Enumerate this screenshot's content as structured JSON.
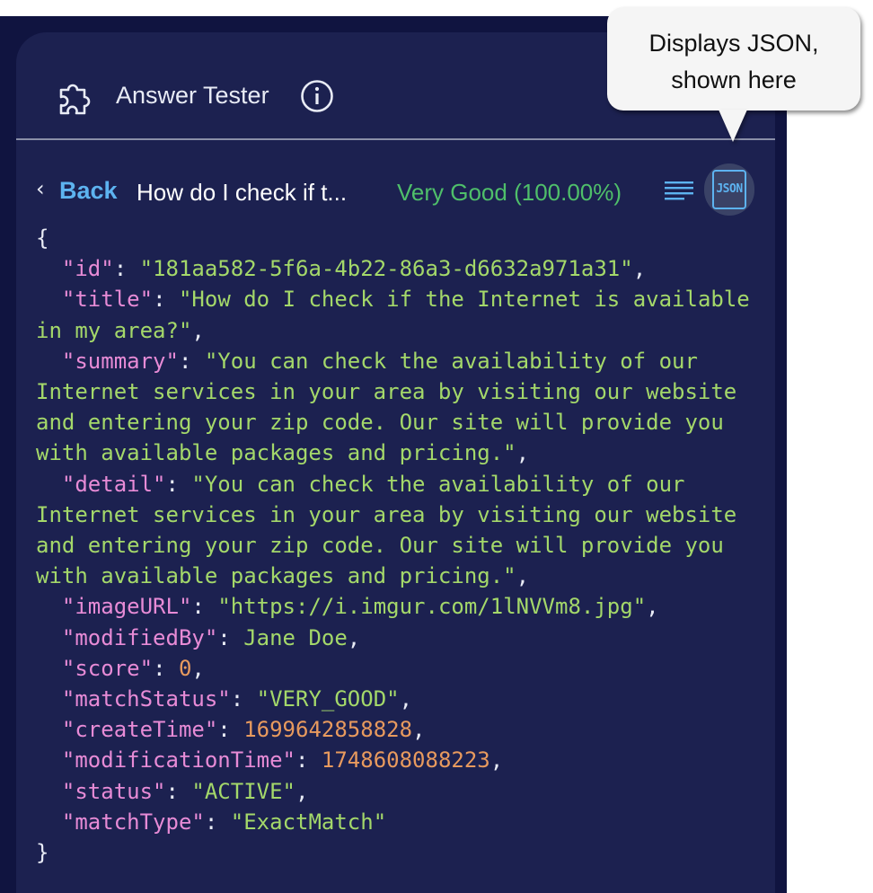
{
  "header": {
    "title": "Answer Tester",
    "icons": [
      "puzzle-icon",
      "info-icon"
    ]
  },
  "toolbar": {
    "back_chevron": "‹",
    "back_label": "Back",
    "question": "How do I check if t...",
    "rating": "Very Good (100.00%)",
    "json_button_label": "JSON",
    "icons": [
      "lines-icon",
      "json-icon"
    ]
  },
  "tooltip": {
    "line1": "Displays JSON,",
    "line2": "shown here"
  },
  "json_view": {
    "open_brace": "{",
    "close_brace": "}",
    "fields": [
      {
        "key": "\"id\"",
        "value": "\"181aa582-5f6a-4b22-86a3-d6632a971a31\"",
        "type": "string"
      },
      {
        "key": "\"title\"",
        "value": "\"How do I check if the Internet is available in my area?\"",
        "type": "string"
      },
      {
        "key": "\"summary\"",
        "value": "\"You can check the availability of our Internet services in your area by visiting our website and entering your zip code. Our site will provide you with available packages and pricing.\"",
        "type": "string"
      },
      {
        "key": "\"detail\"",
        "value": "\"You can check the availability of our Internet services in your area by visiting our website and entering your zip code. Our site will provide you with available packages and pricing.\"",
        "type": "string"
      },
      {
        "key": "\"imageURL\"",
        "value": "\"https://i.imgur.com/1lNVVm8.jpg\"",
        "type": "string"
      },
      {
        "key": "\"modifiedBy\"",
        "value": "Jane Doe",
        "type": "string"
      },
      {
        "key": "\"score\"",
        "value": "0",
        "type": "number"
      },
      {
        "key": "\"matchStatus\"",
        "value": "\"VERY_GOOD\"",
        "type": "string"
      },
      {
        "key": "\"createTime\"",
        "value": "1699642858828",
        "type": "number"
      },
      {
        "key": "\"modificationTime\"",
        "value": "1748608088223",
        "type": "number"
      },
      {
        "key": "\"status\"",
        "value": "\"ACTIVE\"",
        "type": "string"
      },
      {
        "key": "\"matchType\"",
        "value": "\"ExactMatch\"",
        "type": "string"
      }
    ]
  },
  "colors": {
    "panel_bg": "#1c2150",
    "backdrop_bg": "#101440",
    "link_blue": "#5db3f0",
    "rating_green": "#4fbf6a",
    "json_key": "#e78bd6",
    "json_string": "#a4d86a",
    "json_number": "#e89a5e"
  }
}
